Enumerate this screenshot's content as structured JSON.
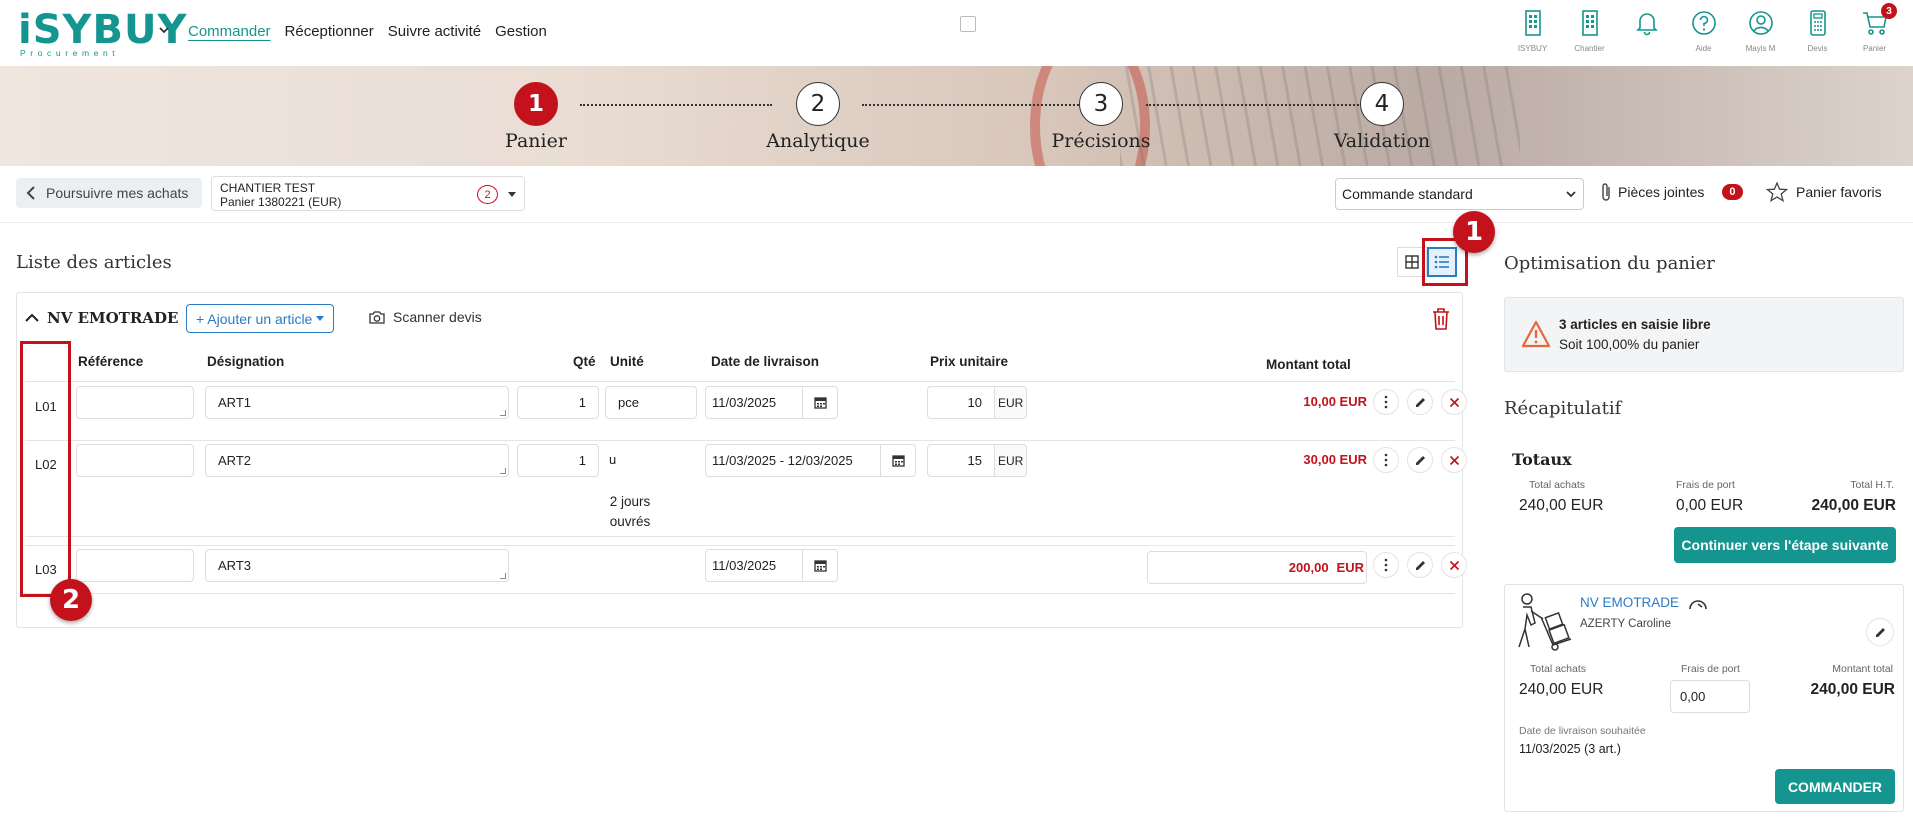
{
  "brand": {
    "logo_text": "iSYBUY",
    "logo_sub": "Procurement"
  },
  "nav": {
    "items": [
      "Commander",
      "Réceptionner",
      "Suivre activité",
      "Gestion"
    ]
  },
  "top_icons": [
    {
      "name": "building-icon",
      "label": "ISYBUY"
    },
    {
      "name": "building-icon",
      "label": "Chantier"
    },
    {
      "name": "bell-icon",
      "label": ""
    },
    {
      "name": "help-icon",
      "label": "Aide"
    },
    {
      "name": "user-icon",
      "label": "Mayis M"
    },
    {
      "name": "calculator-icon",
      "label": "Devis"
    },
    {
      "name": "cart-icon",
      "label": "Panier",
      "badge": "3"
    }
  ],
  "steps": [
    {
      "num": "1",
      "label": "Panier"
    },
    {
      "num": "2",
      "label": "Analytique"
    },
    {
      "num": "3",
      "label": "Précisions"
    },
    {
      "num": "4",
      "label": "Validation"
    }
  ],
  "toolbar": {
    "back_label": "Poursuivre mes achats",
    "cart_line1": "CHANTIER TEST",
    "cart_line2": "Panier 1380221 (EUR)",
    "cart_badge": "2",
    "order_type": "Commande standard",
    "attachments_label": "Pièces jointes",
    "attachments_count": "0",
    "favorites_label": "Panier favoris"
  },
  "list": {
    "title": "Liste des articles",
    "supplier": "NV EMOTRADE",
    "add_label": "+ Ajouter un article",
    "scan_label": "Scanner devis",
    "columns": {
      "reference": "Référence",
      "designation": "Désignation",
      "qty": "Qté",
      "unit": "Unité",
      "delivery": "Date de livraison",
      "unit_price": "Prix unitaire",
      "total": "Montant total"
    },
    "rows": [
      {
        "id": "L01",
        "reference": "",
        "designation": "ART1",
        "qty": "1",
        "unit": "pce",
        "date": "11/03/2025",
        "price": "10",
        "currency": "EUR",
        "total": "10,00 EUR"
      },
      {
        "id": "L02",
        "reference": "",
        "designation": "ART2",
        "qty": "1",
        "unit": "u",
        "date": "11/03/2025 - 12/03/2025",
        "price": "15",
        "currency": "EUR",
        "total": "30,00 EUR",
        "delay_line1": "2 jours",
        "delay_line2": "ouvrés"
      },
      {
        "id": "L03",
        "reference": "",
        "designation": "ART3",
        "qty": "",
        "unit": "",
        "date": "11/03/2025",
        "price": "",
        "currency": "",
        "total_value": "200,00",
        "total_currency": "EUR"
      }
    ]
  },
  "callouts": [
    "1",
    "2"
  ],
  "optimisation": {
    "title": "Optimisation du panier",
    "alert_line1": "3 articles en saisie libre",
    "alert_line2": "Soit 100,00% du panier"
  },
  "recap": {
    "title": "Récapitulatif",
    "totaux": "Totaux",
    "total_achats_label": "Total achats",
    "total_achats": "240,00 EUR",
    "frais_label": "Frais de port",
    "frais": "0,00 EUR",
    "total_ht_label": "Total H.T.",
    "total_ht": "240,00 EUR",
    "continue_label": "Continuer vers l'étape suivante"
  },
  "supplier_card": {
    "name": "NV EMOTRADE",
    "contact": "AZERTY Caroline",
    "total_achats_label": "Total achats",
    "total_achats": "240,00 EUR",
    "frais_label": "Frais de port",
    "frais_value": "0,00",
    "montant_label": "Montant total",
    "montant": "240,00 EUR",
    "delivery_label": "Date de livraison souhaitée",
    "delivery_value": "11/03/2025 (3 art.)",
    "order_label": "COMMANDER"
  },
  "colors": {
    "brand": "#14958f",
    "accent_red": "#c3121c",
    "link_blue": "#2b7bc4"
  }
}
